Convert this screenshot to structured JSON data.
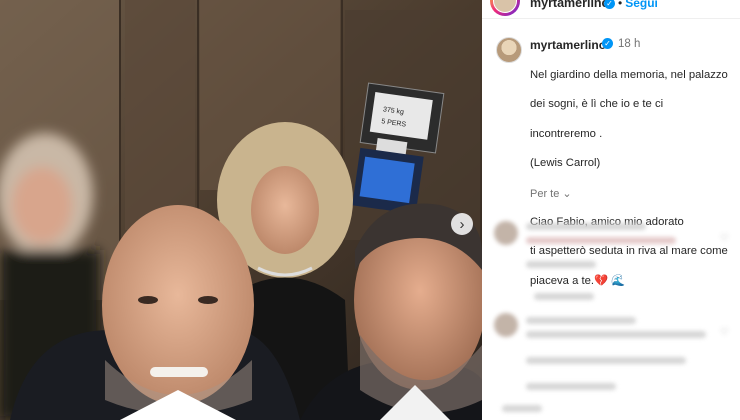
{
  "post": {
    "username": "myrtamerlino",
    "follow_label": "Segui",
    "time": "18 h",
    "caption_lines": [
      "Nel giardino della memoria, nel palazzo",
      "dei sogni, è lì che io e te ci",
      "incontreremo .",
      "(Lewis Carrol)",
      "",
      "Ciao Fabio, amico mio adorato",
      "ti aspetterò seduta in riva al mare come",
      "piaceva a te.💔 🌊"
    ],
    "translate_label": "Per te ⌄"
  },
  "elevator_panel": {
    "label_weight": "375 kg",
    "label_persons": "5 PERS"
  },
  "colors": {
    "link": "#0095f6",
    "text": "#262626",
    "muted": "#737373"
  },
  "icons": [
    "next-arrow-icon",
    "verified-badge-icon"
  ]
}
